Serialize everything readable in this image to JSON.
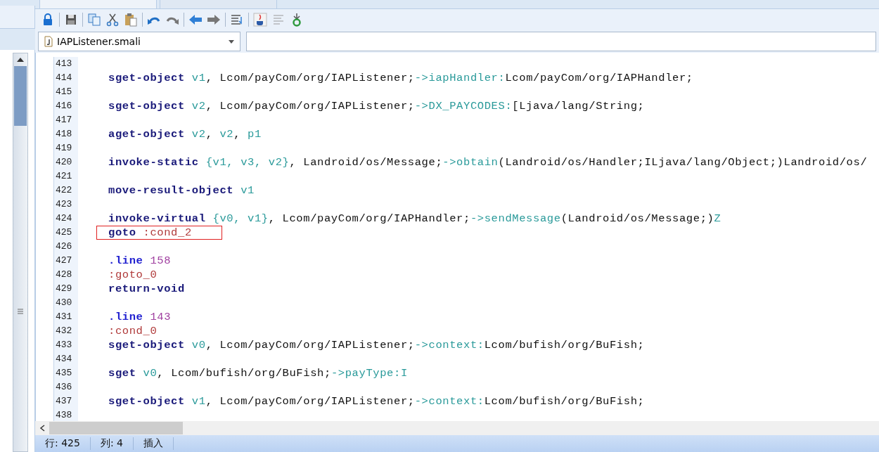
{
  "file_selector": {
    "value": "IAPListener.smali"
  },
  "toolbar": [
    {
      "kind": "lock"
    },
    {
      "kind": "save"
    },
    {
      "kind": "copy"
    },
    {
      "kind": "cut"
    },
    {
      "kind": "paste"
    },
    {
      "kind": "undo"
    },
    {
      "kind": "redo"
    },
    {
      "kind": "back"
    },
    {
      "kind": "forward"
    },
    {
      "kind": "format"
    },
    {
      "kind": "java"
    },
    {
      "kind": "lines"
    },
    {
      "kind": "goto"
    }
  ],
  "lines": [
    {
      "number": "413"
    },
    {
      "number": "414",
      "tokens": [
        {
          "kind": "op",
          "text": "sget-object"
        },
        {
          "kind": "reg",
          "text": " v1"
        },
        {
          "kind": "plain",
          "text": ", Lcom/payCom/org/IAPListener;"
        },
        {
          "kind": "ref",
          "text": "->iapHandler:"
        },
        {
          "kind": "plain",
          "text": "Lcom/payCom/org/IAPHandler;"
        }
      ]
    },
    {
      "number": "415"
    },
    {
      "number": "416",
      "tokens": [
        {
          "kind": "op",
          "text": "sget-object"
        },
        {
          "kind": "reg",
          "text": " v2"
        },
        {
          "kind": "plain",
          "text": ", Lcom/payCom/org/IAPListener;"
        },
        {
          "kind": "ref",
          "text": "->DX_PAYCODES:"
        },
        {
          "kind": "plain",
          "text": "[Ljava/lang/String;"
        }
      ]
    },
    {
      "number": "417"
    },
    {
      "number": "418",
      "tokens": [
        {
          "kind": "op",
          "text": "aget-object"
        },
        {
          "kind": "reg",
          "text": " v2"
        },
        {
          "kind": "plain",
          "text": ", "
        },
        {
          "kind": "reg",
          "text": "v2"
        },
        {
          "kind": "plain",
          "text": ", "
        },
        {
          "kind": "reg",
          "text": "p1"
        }
      ]
    },
    {
      "number": "419"
    },
    {
      "number": "420",
      "tokens": [
        {
          "kind": "op",
          "text": "invoke-static"
        },
        {
          "kind": "reg",
          "text": " {v1, v3, v2}"
        },
        {
          "kind": "plain",
          "text": ", Landroid/os/Message;"
        },
        {
          "kind": "ref",
          "text": "->obtain"
        },
        {
          "kind": "plain",
          "text": "(Landroid/os/Handler;ILjava/lang/Object;)Landroid/os/"
        }
      ]
    },
    {
      "number": "421"
    },
    {
      "number": "422",
      "tokens": [
        {
          "kind": "op",
          "text": "move-result-object"
        },
        {
          "kind": "reg",
          "text": " v1"
        }
      ]
    },
    {
      "number": "423"
    },
    {
      "number": "424",
      "tokens": [
        {
          "kind": "op",
          "text": "invoke-virtual"
        },
        {
          "kind": "reg",
          "text": " {v0, v1}"
        },
        {
          "kind": "plain",
          "text": ", Lcom/payCom/org/IAPHandler;"
        },
        {
          "kind": "ref",
          "text": "->sendMessage"
        },
        {
          "kind": "plain",
          "text": "(Landroid/os/Message;)"
        },
        {
          "kind": "ref",
          "text": "Z"
        }
      ]
    },
    {
      "number": "425",
      "highlighted": true,
      "tokens": [
        {
          "kind": "op",
          "text": "goto"
        },
        {
          "kind": "label",
          "text": " :cond_2"
        }
      ]
    },
    {
      "number": "426"
    },
    {
      "number": "427",
      "tokens": [
        {
          "kind": "directive",
          "text": ".line"
        },
        {
          "kind": "num",
          "text": " 158"
        }
      ]
    },
    {
      "number": "428",
      "tokens": [
        {
          "kind": "label",
          "text": ":goto_0"
        }
      ]
    },
    {
      "number": "429",
      "tokens": [
        {
          "kind": "op",
          "text": "return-void"
        }
      ]
    },
    {
      "number": "430"
    },
    {
      "number": "431",
      "tokens": [
        {
          "kind": "directive",
          "text": ".line"
        },
        {
          "kind": "num",
          "text": " 143"
        }
      ]
    },
    {
      "number": "432",
      "tokens": [
        {
          "kind": "label",
          "text": ":cond_0"
        }
      ]
    },
    {
      "number": "433",
      "tokens": [
        {
          "kind": "op",
          "text": "sget-object"
        },
        {
          "kind": "reg",
          "text": " v0"
        },
        {
          "kind": "plain",
          "text": ", Lcom/payCom/org/IAPListener;"
        },
        {
          "kind": "ref",
          "text": "->context:"
        },
        {
          "kind": "plain",
          "text": "Lcom/bufish/org/BuFish;"
        }
      ]
    },
    {
      "number": "434"
    },
    {
      "number": "435",
      "tokens": [
        {
          "kind": "op",
          "text": "sget"
        },
        {
          "kind": "reg",
          "text": " v0"
        },
        {
          "kind": "plain",
          "text": ", Lcom/bufish/org/BuFish;"
        },
        {
          "kind": "ref",
          "text": "->payType:I"
        }
      ]
    },
    {
      "number": "436"
    },
    {
      "number": "437",
      "tokens": [
        {
          "kind": "op",
          "text": "sget-object"
        },
        {
          "kind": "reg",
          "text": " v1"
        },
        {
          "kind": "plain",
          "text": ", Lcom/payCom/org/IAPListener;"
        },
        {
          "kind": "ref",
          "text": "->context:"
        },
        {
          "kind": "plain",
          "text": "Lcom/bufish/org/BuFish;"
        }
      ]
    },
    {
      "number": "438"
    }
  ],
  "status_bar": [
    {
      "text": "行: 425"
    },
    {
      "text": "列: 4"
    },
    {
      "text": "插入"
    }
  ]
}
